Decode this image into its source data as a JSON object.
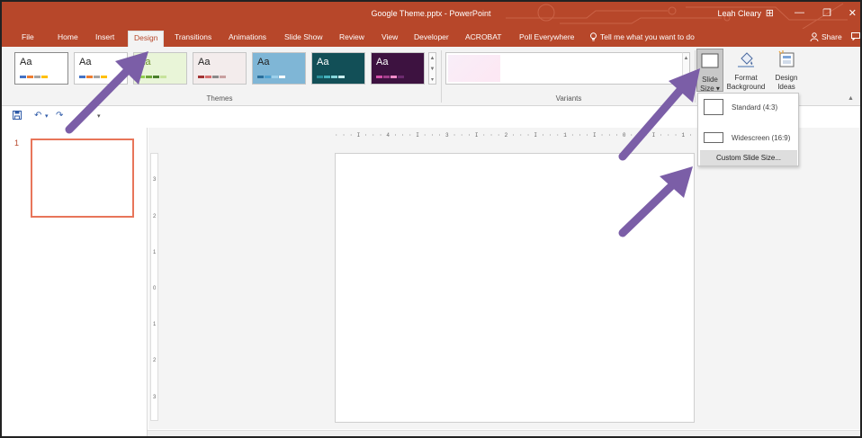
{
  "window": {
    "title": "Google Theme.pptx  -  PowerPoint",
    "user": "Leah Cleary",
    "controls": {
      "ribbon_display": "⊞",
      "minimize": "—",
      "restore": "❐",
      "close": "✕"
    }
  },
  "tabs": [
    {
      "label": "File"
    },
    {
      "label": "Home"
    },
    {
      "label": "Insert"
    },
    {
      "label": "Design",
      "active": true
    },
    {
      "label": "Transitions"
    },
    {
      "label": "Animations"
    },
    {
      "label": "Slide Show"
    },
    {
      "label": "Review"
    },
    {
      "label": "View"
    },
    {
      "label": "Developer"
    },
    {
      "label": "ACROBAT"
    },
    {
      "label": "Poll Everywhere"
    }
  ],
  "tell_me": {
    "text": "Tell me what you want to do"
  },
  "share": {
    "label": "Share"
  },
  "ribbon": {
    "themes": {
      "label": "Themes",
      "items": [
        {
          "aa": "Aa",
          "bg": "#ffffff",
          "text": "#222222",
          "bars": [
            "#4472c4",
            "#ed7d31",
            "#a5a5a5",
            "#ffc000"
          ]
        },
        {
          "aa": "Aa",
          "bg": "#ffffff",
          "text": "#222222",
          "bars": [
            "#4472c4",
            "#ed7d31",
            "#a5a5a5",
            "#ffc000"
          ]
        },
        {
          "aa": "Aa",
          "bg": "#e9f5d8",
          "text": "#6a8f2a",
          "bars": [
            "#92d050",
            "#6fa53b",
            "#4a7f2c",
            "#c7e39c"
          ]
        },
        {
          "aa": "Aa",
          "bg": "#f3ecec",
          "text": "#222222",
          "bars": [
            "#a33434",
            "#d46f6f",
            "#8a8a8a",
            "#c9a0a0"
          ]
        },
        {
          "aa": "Aa",
          "bg": "#7fb6d6",
          "text": "#222222",
          "bars": [
            "#2a6f9c",
            "#4ea0cf",
            "#9cd0ec",
            "#ffffff"
          ]
        },
        {
          "aa": "Aa",
          "bg": "#124f57",
          "text": "#ffffff",
          "bars": [
            "#2b8f9a",
            "#47b2bd",
            "#86d4da",
            "#c9eef0"
          ]
        },
        {
          "aa": "Aa",
          "bg": "#3d1240",
          "text": "#ffffff",
          "bars": [
            "#d24fa8",
            "#a23d8a",
            "#f08bc8",
            "#6b2a6e"
          ]
        }
      ]
    },
    "variants": {
      "label": "Variants"
    },
    "customize": {
      "slide_size": {
        "line1": "Slide",
        "line2": "Size ▾"
      },
      "format_background": {
        "line1": "Format",
        "line2": "Background"
      },
      "design_ideas": {
        "line1": "Design",
        "line2": "Ideas"
      }
    }
  },
  "qat": {
    "save": "💾",
    "undo": "↶",
    "undo_drop": "▾",
    "redo": "↷",
    "customize": "▾"
  },
  "slides": [
    {
      "number": "1"
    }
  ],
  "ruler": {
    "horizontal": "· · · I · · · 4 · · · I · · · 3 · · · I · · · 2 · · · I · · · 1 · · · I · · · 0 · · · I · · · 1 · · · I · · · 2 · · · I · · · 3 · · · I · · · 4 · · · I · · ·",
    "vertical": [
      "3",
      "2",
      "1",
      "0",
      "1",
      "2",
      "3"
    ]
  },
  "slide_size_menu": {
    "standard": "Standard (4:3)",
    "widescreen": "Widescreen (16:9)",
    "custom": "Custom Slide Size..."
  },
  "colors": {
    "accent": "#b7472a",
    "annotation_arrow": "#7b5ea7"
  }
}
